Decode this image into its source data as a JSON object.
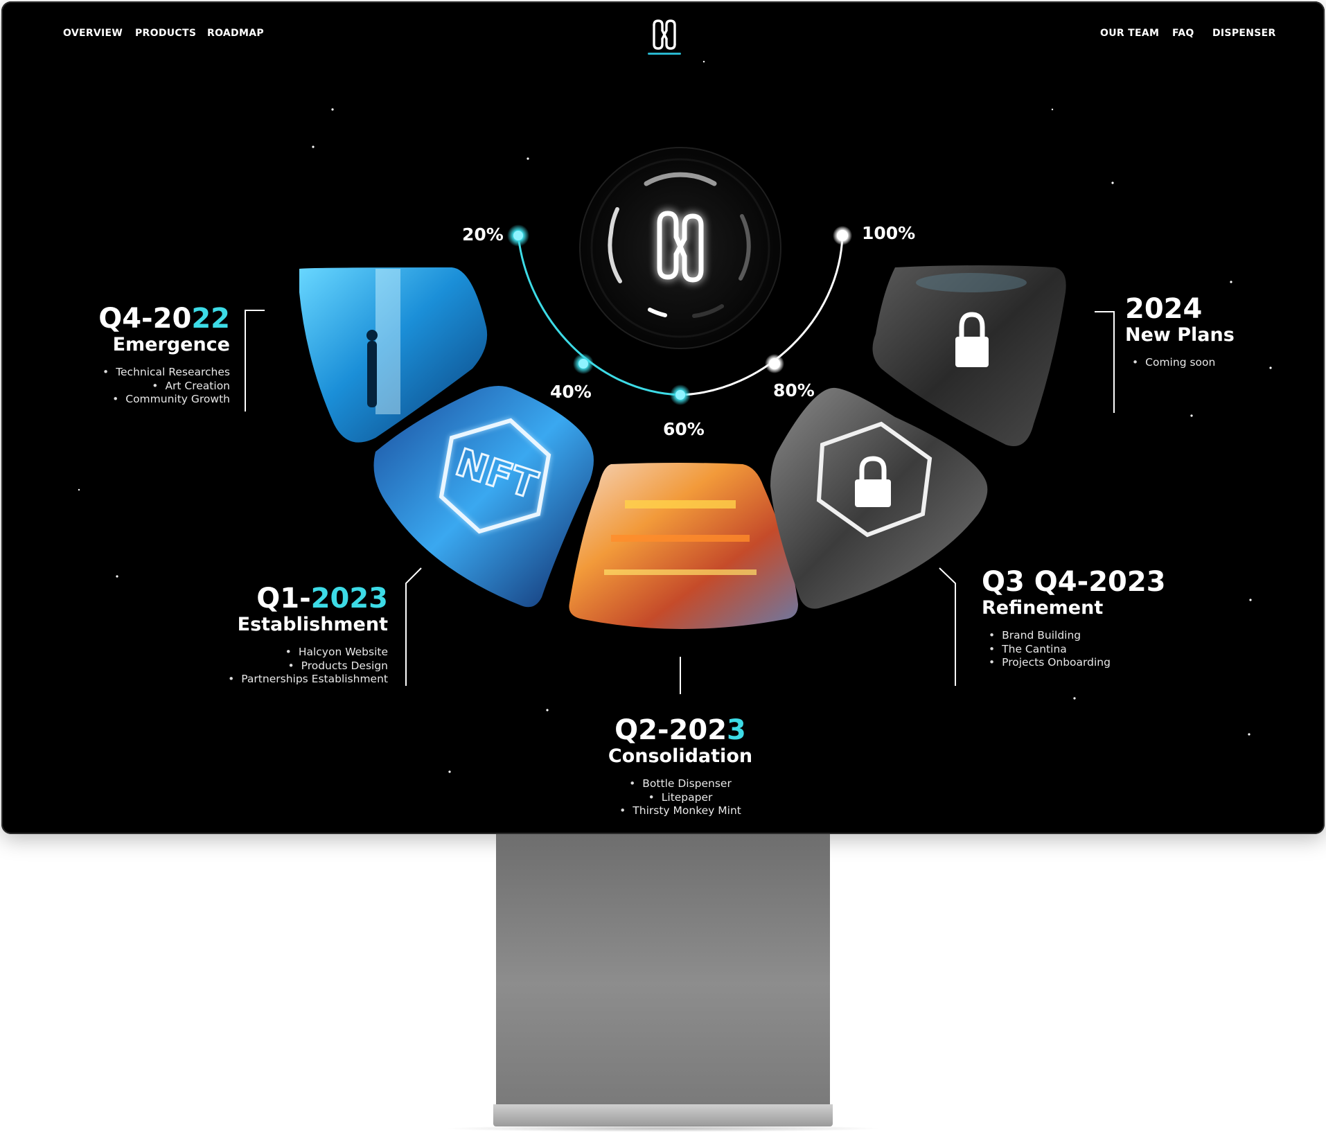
{
  "nav": {
    "left": [
      "OVERVIEW",
      "PRODUCTS",
      "ROADMAP"
    ],
    "right": [
      "OUR TEAM",
      "FAQ",
      "DISPENSER"
    ],
    "active_color": "#29b7cf"
  },
  "progress": {
    "markers": [
      "20%",
      "40%",
      "60%",
      "80%",
      "100%"
    ],
    "accent_color": "#3ddbe6"
  },
  "phases": {
    "q4_2022": {
      "date_prefix": "Q4-20",
      "date_highlight": "22",
      "title": "Emergence",
      "items": [
        "Technical Researches",
        "Art Creation",
        "Community Growth"
      ]
    },
    "q1_2023": {
      "date_prefix": "Q1-",
      "date_highlight": "2023",
      "title": "Establishment",
      "items": [
        "Halcyon Website",
        "Products Design",
        "Partnerships Establishment"
      ]
    },
    "q2_2023": {
      "date_prefix": "Q2-202",
      "date_highlight": "3",
      "title": "Consolidation",
      "items": [
        "Bottle Dispenser",
        "Litepaper",
        "Thirsty Monkey Mint"
      ]
    },
    "q3q4_2023": {
      "date_prefix": "Q3 Q4-2023",
      "date_highlight": "",
      "title": "Refinement",
      "items": [
        "Brand Building",
        "The Cantina",
        "Projects Onboarding"
      ]
    },
    "y2024": {
      "date_prefix": "2024",
      "date_highlight": "",
      "title": "New Plans",
      "items": [
        "Coming soon"
      ]
    }
  },
  "tiles": {
    "nft_label": "NFT"
  }
}
